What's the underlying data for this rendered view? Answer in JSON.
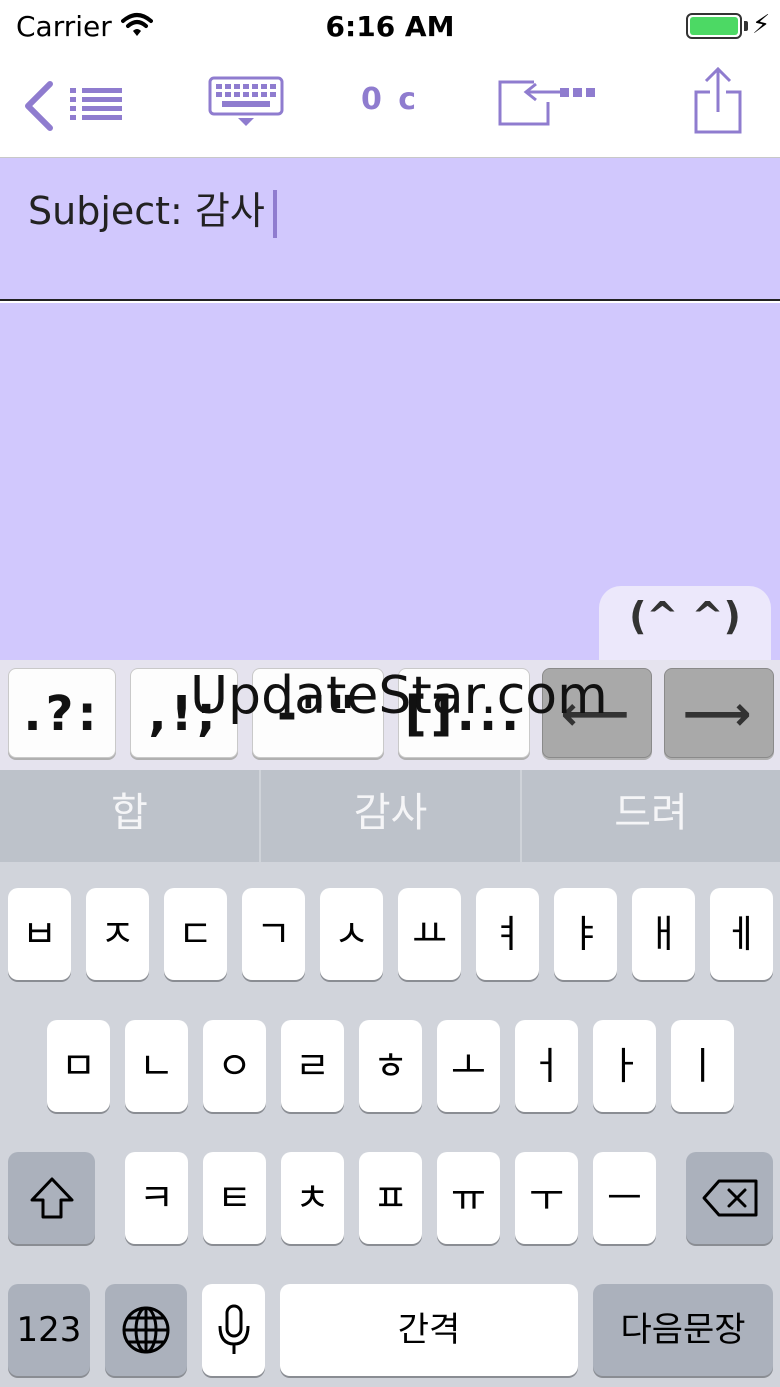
{
  "status_bar": {
    "carrier": "Carrier",
    "time": "6:16 AM",
    "battery": 1.0
  },
  "toolbar": {
    "back_icon": "chevron-left-icon",
    "list_icon": "list-icon",
    "keyboard_icon": "keyboard-hide-icon",
    "char_count": "0 c",
    "cursor_move_icon": "cursor-move-icon",
    "share_icon": "share-icon"
  },
  "subject": {
    "text": "Subject: 감사"
  },
  "emoticon_tab": {
    "label": "(^ ^)"
  },
  "punctuation_keys": [
    {
      "label": ".?:"
    },
    {
      "label": ",!;"
    },
    {
      "label": "-\"\""
    },
    {
      "label": "[]..."
    },
    {
      "label": "⟵",
      "icon": "arrow-left-icon"
    },
    {
      "label": "⟶",
      "icon": "arrow-right-icon"
    }
  ],
  "watermark": "UpdateStar.com",
  "predictions": [
    "합",
    "감사",
    "드려"
  ],
  "keyboard": {
    "row1": [
      "ㅂ",
      "ㅈ",
      "ㄷ",
      "ㄱ",
      "ㅅ",
      "ㅛ",
      "ㅕ",
      "ㅑ",
      "ㅐ",
      "ㅔ"
    ],
    "row2": [
      "ㅁ",
      "ㄴ",
      "ㅇ",
      "ㄹ",
      "ㅎ",
      "ㅗ",
      "ㅓ",
      "ㅏ",
      "ㅣ"
    ],
    "row3": [
      "ㅋ",
      "ㅌ",
      "ㅊ",
      "ㅍ",
      "ㅠ",
      "ㅜ",
      "ㅡ"
    ],
    "numbers_key": "123",
    "space_key": "간격",
    "return_key": "다음문장",
    "shift_icon": "shift-icon",
    "delete_icon": "delete-icon",
    "globe_icon": "globe-icon",
    "mic_icon": "microphone-icon"
  },
  "colors": {
    "accent": "#8f7ccf",
    "compose_bg": "#d1c8fd",
    "keyboard_bg": "#d1d4db"
  }
}
